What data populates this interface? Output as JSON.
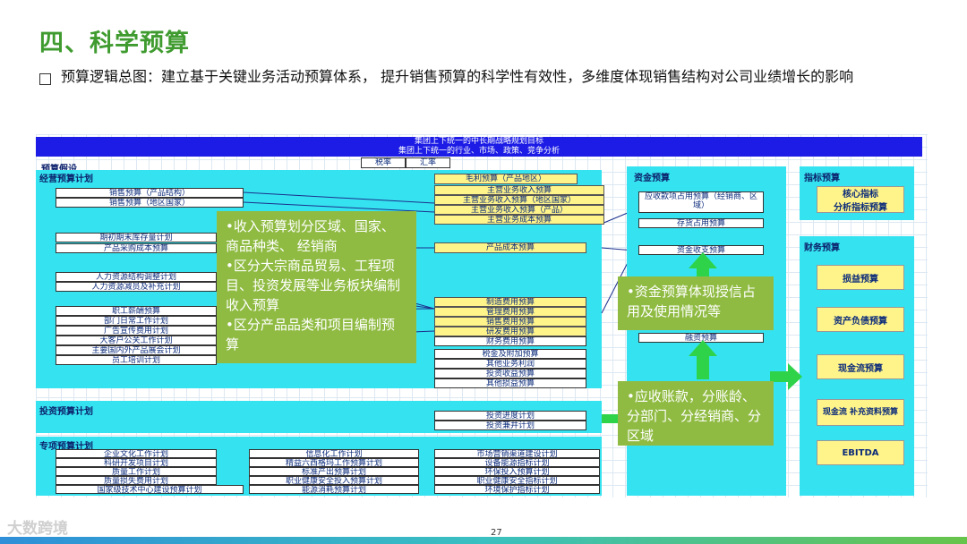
{
  "title": "四、科学预算",
  "subtitle": "预算逻辑总图：建立基于关键业务活动预算体系， 提升销售预算的科学性有效性，多维度体现销售结构对公司业绩增长的影响",
  "diagram": {
    "band1": "集团上下统一的中长期战略规划目标",
    "band2": "集团上下统一的行业、市场、政策、竞争分析",
    "rate_tax": "税率",
    "rate_fx": "汇率",
    "budget_assumption": "预算假设",
    "operating_plan": "经营预算计划",
    "left_boxes": [
      "销售预算（产品结构）",
      "销售预算（地区国家）",
      "期初期末库存量计划",
      "产品采购成本预算",
      "人力资源结构调整计划",
      "人力资源减员及补充计划",
      "职工薪酬预算",
      "部门日常工作计划",
      "广告宣传费用计划",
      "大客户公关工作计划",
      "主要国内外产品展会计划",
      "员工培训计划"
    ],
    "mid_top": [
      "毛利预算（产品地区）",
      "主营业务收入预算",
      "主营业务收入预算（地区国家）",
      "主营业务收入预算（产品）",
      "主营业务成本预算"
    ],
    "mid_cost": "产品成本预算",
    "mid_expense": [
      "制造费用预算",
      "管理费用预算",
      "销售费用预算",
      "研发费用预算",
      "财务费用预算"
    ],
    "mid_other": [
      "税金及附加预算",
      "其他业务利润",
      "投资收益预算",
      "其他损益预算"
    ],
    "investment_plan": "投资预算计划",
    "investment_boxes": [
      "投资进度计划",
      "投资兼并计划"
    ],
    "special_plan": "专项预算计划",
    "special_col1": [
      "企业文化工作计划",
      "科研开发项目计划",
      "质量工作计划",
      "质量损失费用计划",
      "国家级技术中心建设预算计划"
    ],
    "special_col2": [
      "信息化工作计划",
      "精益六西格玛工作预算计划",
      "标准产出预算计划",
      "职业健康安全投入预算计划",
      "能源消耗预算计划"
    ],
    "special_col3": [
      "市场营销渠道建设计划",
      "设备能源指标计划",
      "环保投入预算计划",
      "职业健康安全指标计划",
      "环境保护指标计划"
    ],
    "fund_budget": "资金预算",
    "fund_boxes": [
      "应收款项占用预算（经销商、区域）",
      "存货占用预算",
      "资金收支预算",
      "融资预算"
    ],
    "indicator_budget": "指标预算",
    "indicator_box": [
      "核心指标",
      "分析指标预算"
    ],
    "finance_budget": "财务预算",
    "finance_boxes": [
      "损益预算",
      "资产负债预算",
      "现金流预算",
      "现金流 补充资料预算",
      "EBITDA"
    ],
    "notes": {
      "revenue": [
        "•收入预算划分区域、国家、商品种类、 经销商",
        "•区分大宗商品贸易、工程项目、投资发展等业务板块编制收入预算",
        "•区分产品品类和项目编制预算"
      ],
      "fund": "•资金预算体现授信占用及使用情况等",
      "receivable": "•应收账款，分账龄、分部门、分经销商、分区域"
    }
  },
  "footer": {
    "logo": "大数跨境",
    "page": "27"
  }
}
